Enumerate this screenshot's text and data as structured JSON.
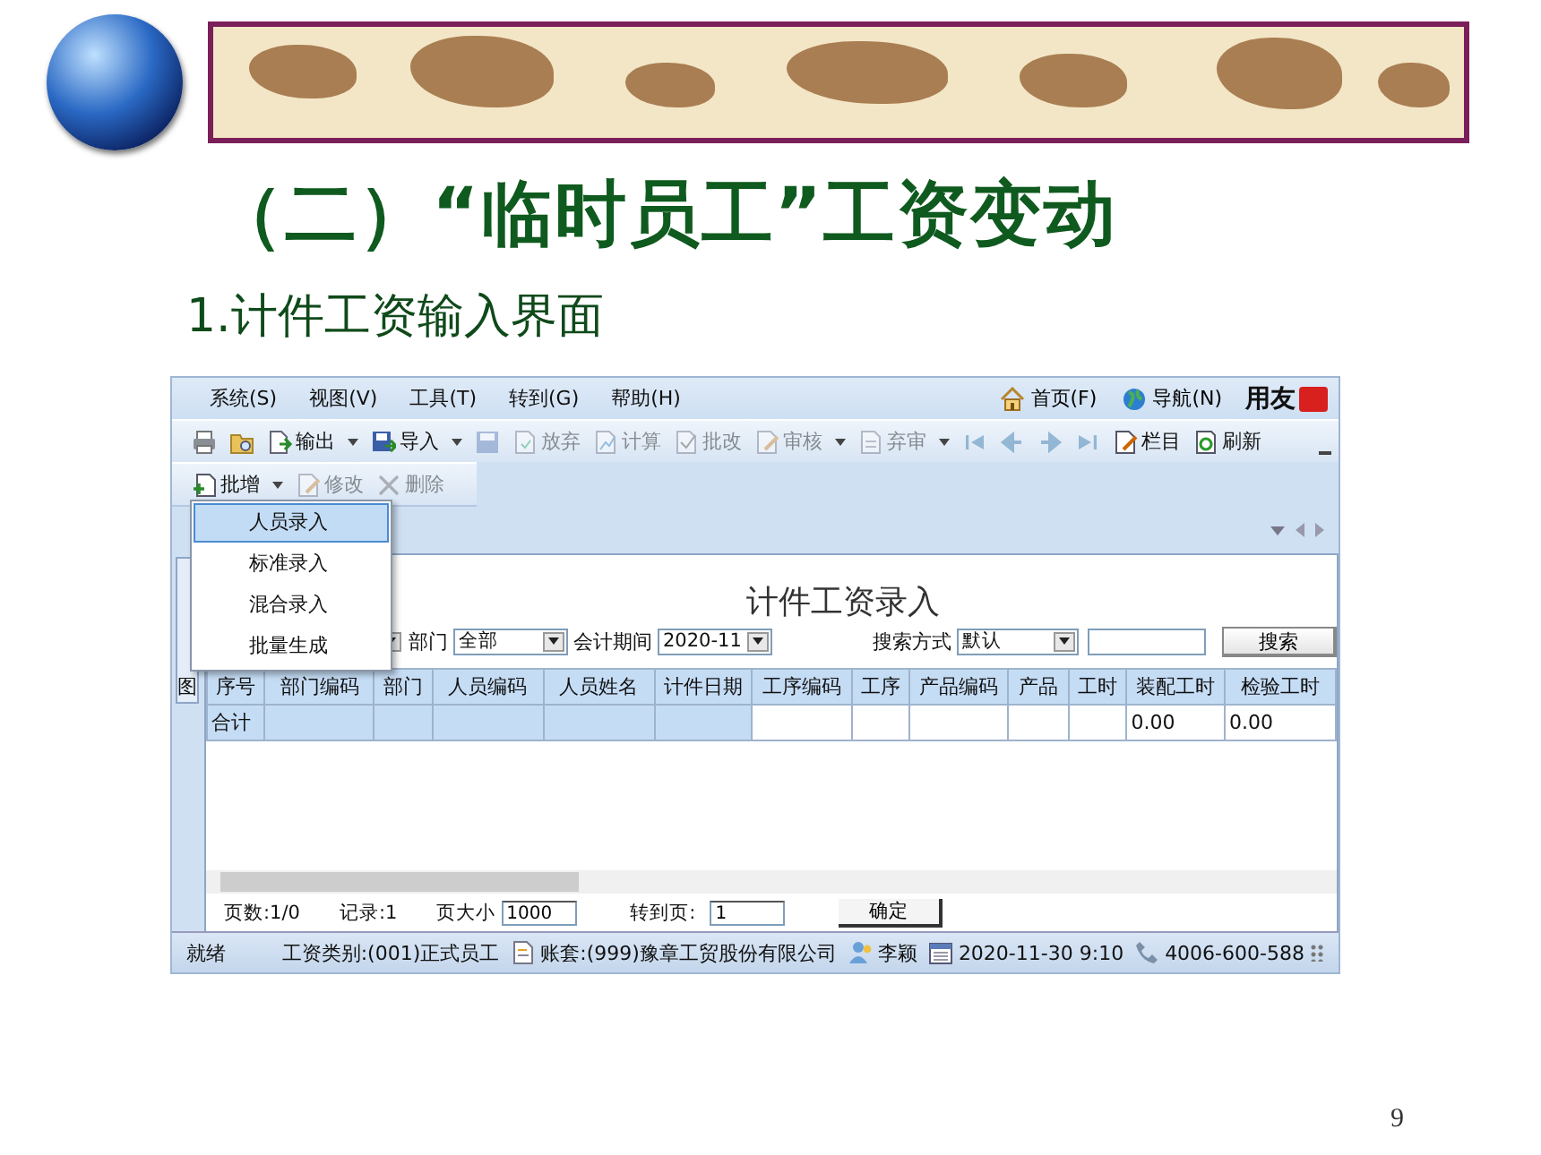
{
  "slide": {
    "title": "（二）“临时员工”工资变动",
    "subtitle": "1.计件工资输入界面",
    "page_number": "9"
  },
  "app": {
    "menu": [
      {
        "label": "系统(S)"
      },
      {
        "label": "视图(V)"
      },
      {
        "label": "工具(T)"
      },
      {
        "label": "转到(G)"
      },
      {
        "label": "帮助(H)"
      }
    ],
    "top_links": [
      {
        "kind": "home",
        "label": "首页(F)"
      },
      {
        "kind": "globe",
        "label": "导航(N)"
      }
    ],
    "brand": "用友",
    "toolbar": [
      {
        "kind": "printer",
        "disabled": false,
        "dropdown": false
      },
      {
        "kind": "preview",
        "disabled": false,
        "dropdown": false
      },
      {
        "kind": "export",
        "label": "输出",
        "disabled": false,
        "dropdown": true
      },
      {
        "kind": "import",
        "label": "导入",
        "disabled": false,
        "dropdown": true
      },
      {
        "kind": "save",
        "disabled": true,
        "dropdown": false
      },
      {
        "kind": "discard",
        "label": "放弃",
        "disabled": true,
        "dropdown": false
      },
      {
        "kind": "calc",
        "label": "计算",
        "disabled": true,
        "dropdown": false
      },
      {
        "kind": "batch_edit",
        "label": "批改",
        "disabled": true,
        "dropdown": false
      },
      {
        "kind": "audit",
        "label": "审核",
        "disabled": true,
        "dropdown": true
      },
      {
        "kind": "unaudit",
        "label": "弃审",
        "disabled": true,
        "dropdown": true
      },
      {
        "kind": "first",
        "disabled": true,
        "dropdown": false
      },
      {
        "kind": "prev",
        "disabled": true,
        "dropdown": false
      },
      {
        "kind": "next",
        "disabled": true,
        "dropdown": false
      },
      {
        "kind": "last",
        "disabled": true,
        "dropdown": false
      },
      {
        "kind": "columns",
        "label": "栏目",
        "disabled": false,
        "dropdown": false
      },
      {
        "kind": "refresh",
        "label": "刷新",
        "disabled": false,
        "dropdown": false
      }
    ],
    "toolbar2": [
      {
        "kind": "batch_add",
        "label": "批增",
        "disabled": false,
        "dropdown": true
      },
      {
        "kind": "edit",
        "label": "修改",
        "disabled": true,
        "dropdown": false
      },
      {
        "kind": "delete",
        "label": "删除",
        "disabled": true,
        "dropdown": false
      }
    ],
    "batch_menu": [
      {
        "label": "人员录入",
        "selected": true
      },
      {
        "label": "标准录入",
        "selected": false
      },
      {
        "label": "混合录入",
        "selected": false
      },
      {
        "label": "批量生成",
        "selected": false
      }
    ],
    "side_tab": "图",
    "form_title": "计件工资录入",
    "filters": [
      {
        "label": "部门",
        "value": "全部"
      },
      {
        "label": "会计期间",
        "value": "2020-11"
      }
    ],
    "search": {
      "label": "搜索方式",
      "value": "默认",
      "button": "搜索"
    },
    "table": {
      "columns": [
        {
          "label": "序号",
          "frozen": true,
          "total": "合计"
        },
        {
          "label": "部门编码",
          "frozen": true
        },
        {
          "label": "部门",
          "frozen": true
        },
        {
          "label": "人员编码",
          "frozen": true
        },
        {
          "label": "人员姓名",
          "frozen": true
        },
        {
          "label": "计件日期",
          "frozen": true
        },
        {
          "label": "工序编码",
          "frozen": false
        },
        {
          "label": "工序",
          "frozen": false
        },
        {
          "label": "产品编码",
          "frozen": false
        },
        {
          "label": "产品",
          "frozen": false
        },
        {
          "label": "工时",
          "frozen": false
        },
        {
          "label": "装配工时",
          "frozen": false,
          "total": "0.00"
        },
        {
          "label": "检验工时",
          "frozen": false,
          "total": "0.00"
        }
      ]
    },
    "pager": {
      "pages": "页数:1/0",
      "records": "记录:1",
      "page_size_label": "页大小",
      "page_size": "1000",
      "goto_label": "转到页:",
      "goto": "1",
      "button": "确定"
    },
    "status_bar": {
      "ready": "就绪",
      "items": [
        {
          "kind": "plain",
          "label": "工资类别:(001)正式员工"
        },
        {
          "kind": "account",
          "label": "账套:(999)豫章工贸股份有限公司"
        },
        {
          "kind": "user",
          "label": "李颖"
        },
        {
          "kind": "date",
          "label": "2020-11-30 9:10"
        },
        {
          "kind": "phone",
          "label": "4006-600-588"
        }
      ]
    }
  }
}
